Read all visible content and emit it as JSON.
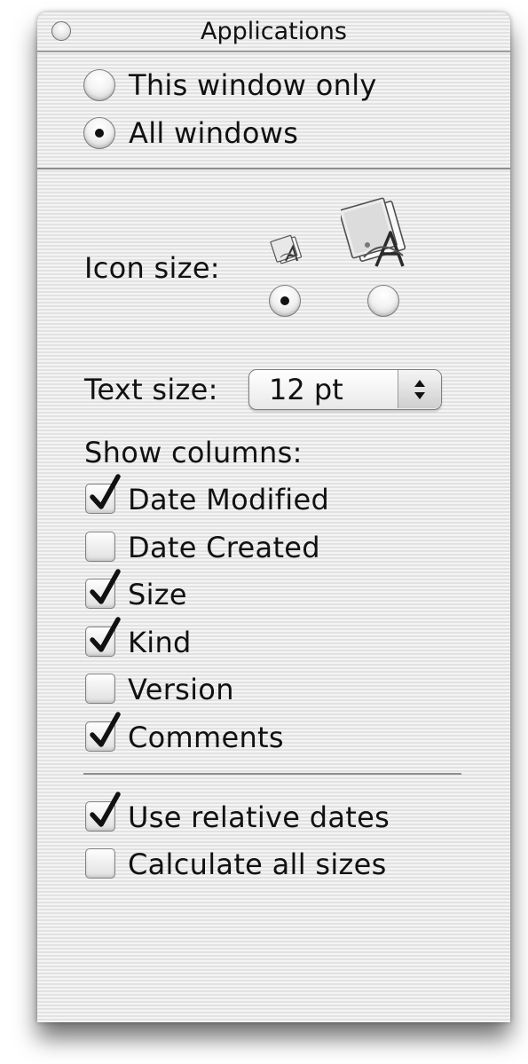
{
  "window": {
    "title": "Applications",
    "close_icon": "close-button-icon"
  },
  "scope": {
    "options": [
      {
        "label": "This window only",
        "selected": false
      },
      {
        "label": "All windows",
        "selected": true
      }
    ]
  },
  "icon_size": {
    "label": "Icon size:",
    "options": [
      {
        "name": "small-app-icon",
        "selected": true
      },
      {
        "name": "large-app-icon",
        "selected": false
      }
    ]
  },
  "text_size": {
    "label": "Text size:",
    "value": "12 pt"
  },
  "columns": {
    "header": "Show columns:",
    "items": [
      {
        "label": "Date Modified",
        "checked": true
      },
      {
        "label": "Date Created",
        "checked": false
      },
      {
        "label": "Size",
        "checked": true
      },
      {
        "label": "Kind",
        "checked": true
      },
      {
        "label": "Version",
        "checked": false
      },
      {
        "label": "Comments",
        "checked": true
      }
    ]
  },
  "options": {
    "items": [
      {
        "label": "Use relative dates",
        "checked": true
      },
      {
        "label": "Calculate all sizes",
        "checked": false
      }
    ]
  }
}
